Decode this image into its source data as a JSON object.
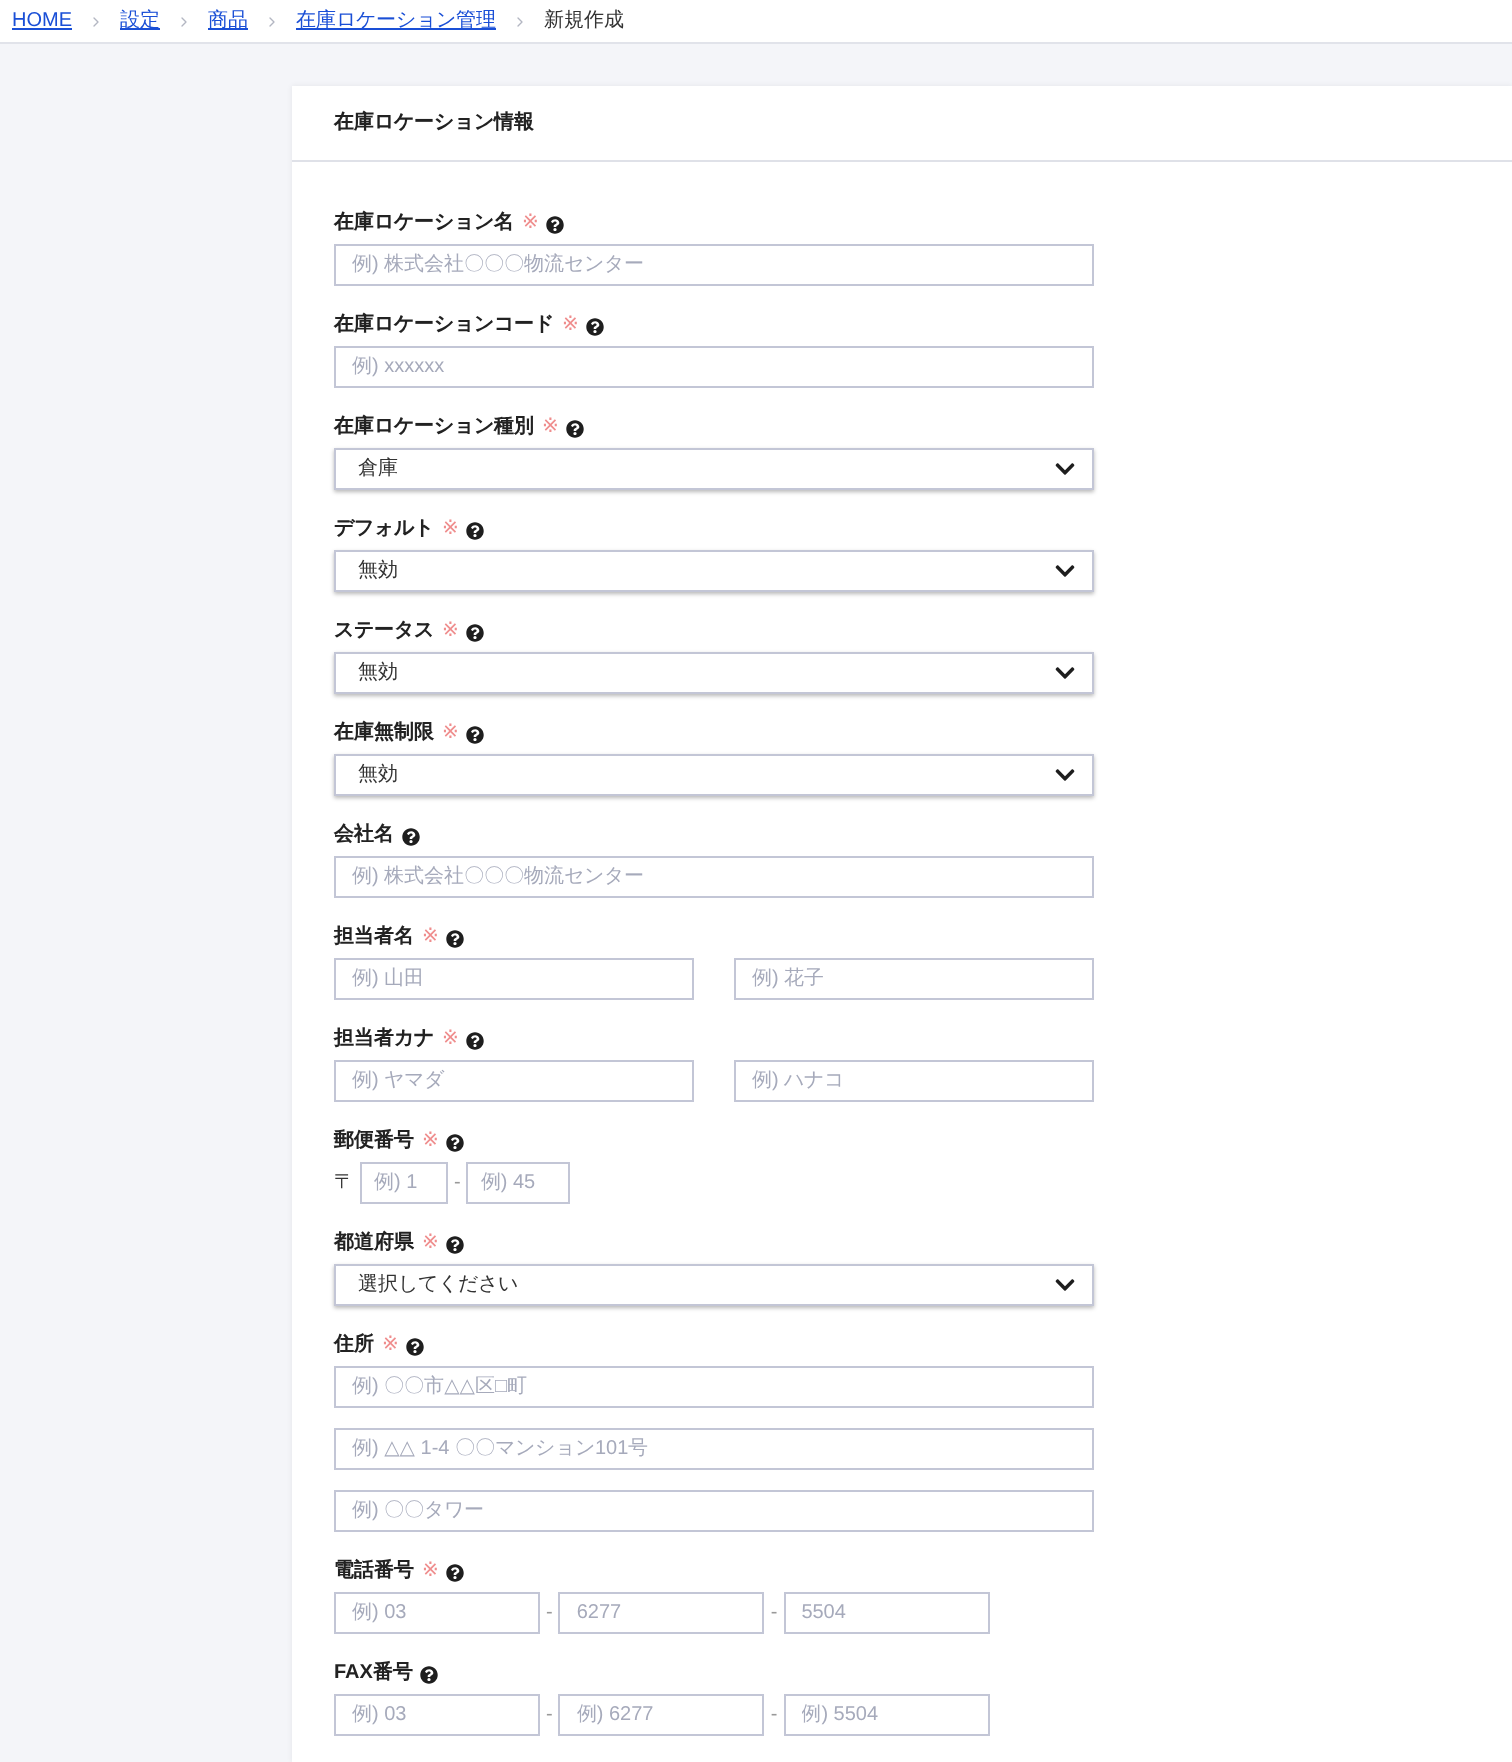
{
  "breadcrumb": [
    {
      "label": "HOME",
      "current": false
    },
    {
      "label": "設定",
      "current": false
    },
    {
      "label": "商品",
      "current": false
    },
    {
      "label": "在庫ロケーション管理",
      "current": false
    },
    {
      "label": "新規作成",
      "current": true
    }
  ],
  "card": {
    "title": "在庫ロケーション情報",
    "fields": [
      {
        "label": "在庫ロケーション名",
        "required_mark": "※",
        "kind": "text",
        "inputs": [
          {
            "placeholder": "例) 株式会社〇〇〇物流センター"
          }
        ]
      },
      {
        "label": "在庫ロケーションコード",
        "required_mark": "※",
        "kind": "text",
        "inputs": [
          {
            "placeholder": "例) xxxxxx"
          }
        ]
      },
      {
        "label": "在庫ロケーション種別",
        "required_mark": "※",
        "kind": "select",
        "value": "倉庫"
      },
      {
        "label": "デフォルト",
        "required_mark": "※",
        "kind": "select",
        "value": "無効"
      },
      {
        "label": "ステータス",
        "required_mark": "※",
        "kind": "select",
        "value": "無効"
      },
      {
        "label": "在庫無制限",
        "required_mark": "※",
        "kind": "select",
        "value": "無効"
      },
      {
        "label": "会社名",
        "kind": "text",
        "inputs": [
          {
            "placeholder": "例) 株式会社〇〇〇物流センター"
          }
        ]
      },
      {
        "label": "担当者名",
        "required_mark": "※",
        "kind": "pair",
        "inputs": [
          {
            "placeholder": "例) 山田"
          },
          {
            "placeholder": "例) 花子"
          }
        ]
      },
      {
        "label": "担当者カナ",
        "required_mark": "※",
        "kind": "pair",
        "inputs": [
          {
            "placeholder": "例) ヤマダ"
          },
          {
            "placeholder": "例) ハナコ"
          }
        ]
      },
      {
        "label": "郵便番号",
        "required_mark": "※",
        "kind": "postal",
        "inputs": [
          {
            "prefix": "〒",
            "placeholder": "例) 1"
          },
          {
            "prefix": "-",
            "placeholder": "例) 45"
          }
        ]
      },
      {
        "label": "都道府県",
        "required_mark": "※",
        "kind": "select",
        "value": "選択してください"
      },
      {
        "label": "住所",
        "required_mark": "※",
        "kind": "text",
        "inputs": [
          {
            "placeholder": "例) 〇〇市△△区□町"
          },
          {
            "placeholder": "例) △△ 1-4 〇〇マンション101号"
          },
          {
            "placeholder": "例) 〇〇タワー"
          }
        ]
      },
      {
        "label": "電話番号",
        "required_mark": "※",
        "kind": "phone",
        "inputs": [
          {
            "placeholder": "例) 03"
          },
          {
            "prefix": "-",
            "placeholder": "6277"
          },
          {
            "prefix": "-",
            "placeholder": "5504"
          }
        ]
      },
      {
        "label": "FAX番号",
        "kind": "phone",
        "inputs": [
          {
            "placeholder": "例) 03"
          },
          {
            "prefix": "-",
            "placeholder": "例) 6277"
          },
          {
            "prefix": "-",
            "placeholder": "例) 5504"
          }
        ]
      }
    ]
  }
}
